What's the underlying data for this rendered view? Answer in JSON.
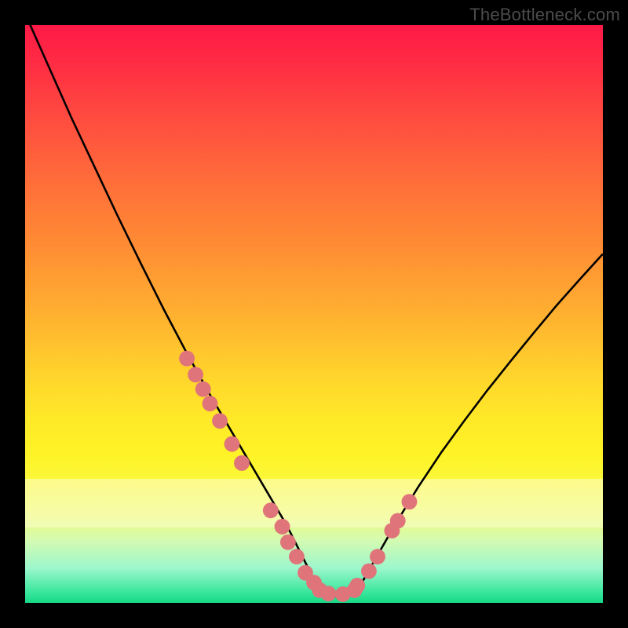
{
  "watermark": "TheBottleneck.com",
  "chart_data": {
    "type": "line",
    "title": "",
    "xlabel": "",
    "ylabel": "",
    "xlim": [
      0,
      100
    ],
    "ylim": [
      0,
      100
    ],
    "grid": false,
    "legend": false,
    "series": [
      {
        "name": "curve",
        "x": [
          0,
          4,
          8,
          12,
          16,
          20,
          24,
          28,
          30,
          32,
          34,
          36,
          38,
          40,
          42,
          44,
          45,
          46,
          48,
          50,
          52,
          54,
          56,
          58,
          60,
          64,
          68,
          72,
          76,
          80,
          84,
          88,
          92,
          96,
          100
        ],
        "y": [
          102,
          93,
          84,
          75.5,
          67,
          58.8,
          50.8,
          43.2,
          39.6,
          36,
          32.6,
          29.2,
          25.8,
          22.4,
          19,
          15.6,
          13.9,
          12,
          8,
          4,
          2,
          1,
          1,
          3,
          6.5,
          13.5,
          20,
          26,
          31.5,
          36.8,
          41.8,
          46.7,
          51.5,
          56,
          60.4
        ]
      },
      {
        "name": "markers",
        "x": [
          28,
          29.5,
          30.8,
          32,
          33.7,
          35.8,
          37.5,
          42.5,
          44.5,
          45.5,
          47,
          48.5,
          50,
          51,
          52.5,
          55,
          57,
          57.5,
          59.5,
          61,
          63.5,
          64.5,
          66.5
        ],
        "y": [
          42.3,
          39.5,
          37,
          34.5,
          31.5,
          27.5,
          24.2,
          16,
          13.2,
          10.5,
          8,
          5.2,
          3.5,
          2.2,
          1.6,
          1.5,
          2.2,
          3.0,
          5.5,
          8.0,
          12.5,
          14.2,
          17.5
        ]
      }
    ],
    "marker_color": "#e0747b",
    "curve_color": "#000000"
  }
}
